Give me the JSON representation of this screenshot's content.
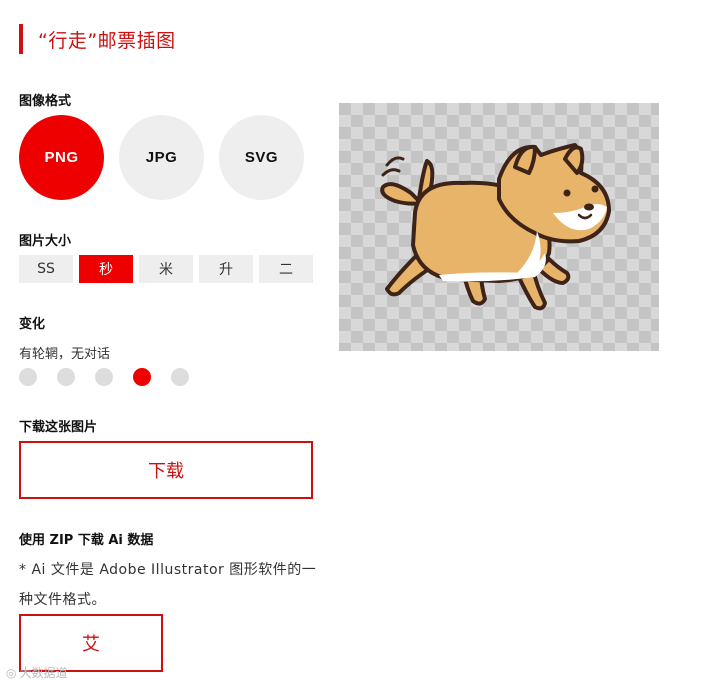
{
  "header": {
    "title": "“行走”邮票插图"
  },
  "format": {
    "label": "图像格式",
    "options": [
      "PNG",
      "JPG",
      "SVG"
    ],
    "selected": "PNG"
  },
  "size": {
    "label": "图片大小",
    "options": [
      "SS",
      "秒",
      "米",
      "升",
      "二"
    ],
    "selected": "秒"
  },
  "variation": {
    "label": "变化",
    "current_text": "有轮辋，无对话",
    "count": 5,
    "selected_index": 3
  },
  "download": {
    "label": "下载这张图片",
    "button": "下载"
  },
  "ai": {
    "label": "使用 ZIP 下载 Ai 数据",
    "note": "* Ai 文件是 Adobe Illustrator 图形软件的一种文件格式。",
    "button": "艾"
  },
  "preview": {
    "subject": "walking shiba dog illustration"
  },
  "watermark": {
    "text": "大数据道"
  },
  "colors": {
    "accent": "#ee0000",
    "accent_dark": "#cc1111",
    "inactive": "#eeeeee"
  }
}
